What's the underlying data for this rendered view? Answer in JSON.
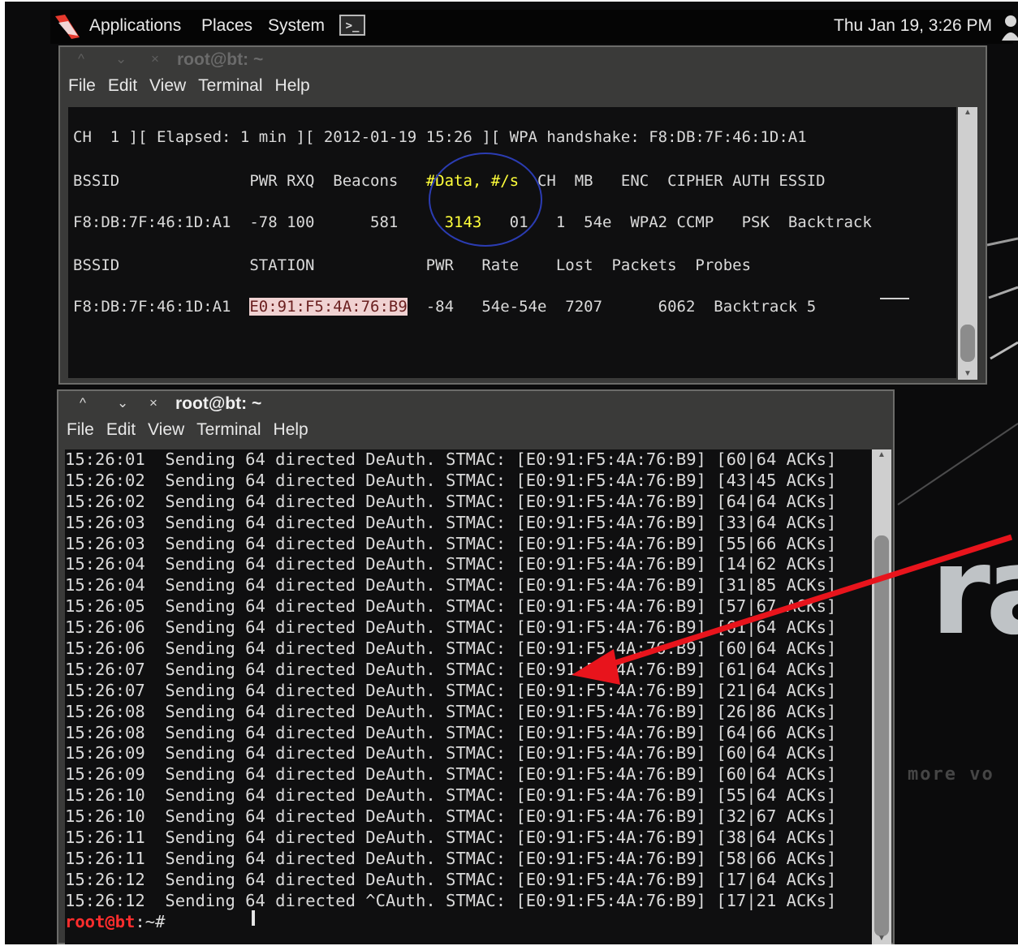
{
  "panel": {
    "menus": [
      "Applications",
      "Places",
      "System"
    ],
    "clock": "Thu Jan 19,  3:26 PM",
    "logo_icon": "backtrack-dragon-logo",
    "terminal_icon_label": ">_"
  },
  "window1": {
    "title": "root@bt: ~",
    "menu": [
      "File",
      "Edit",
      "View",
      "Terminal",
      "Help"
    ],
    "status_line": "CH  1 ][ Elapsed: 1 min ][ 2012-01-19 15:26 ][ WPA handshake: F8:DB:7F:46:1D:A1",
    "ap_header_a": "BSSID              PWR RXQ  Beacons   ",
    "ap_header_data": "#Data, #/s",
    "ap_header_b": "  CH  MB   ENC  CIPHER AUTH ESSID",
    "ap_row_a": "F8:DB:7F:46:1D:A1  -78 100      581     ",
    "ap_row_data": "3143",
    "ap_row_b": "   01   1  54e  WPA2 CCMP   PSK  Backtrack",
    "st_header": "BSSID              STATION            PWR   Rate    Lost  Packets  Probes",
    "st_row_bssid": "F8:DB:7F:46:1D:A1  ",
    "st_row_station": "E0:91:F5:4A:76:B9",
    "st_row_rest": "  -84   54e-54e  7207      6062  Backtrack 5"
  },
  "window2": {
    "title": "root@bt: ~",
    "menu": [
      "File",
      "Edit",
      "View",
      "Terminal",
      "Help"
    ],
    "lines": [
      "15:26:01  Sending 64 directed DeAuth. STMAC: [E0:91:F5:4A:76:B9] [60|64 ACKs]",
      "15:26:02  Sending 64 directed DeAuth. STMAC: [E0:91:F5:4A:76:B9] [43|45 ACKs]",
      "15:26:02  Sending 64 directed DeAuth. STMAC: [E0:91:F5:4A:76:B9] [64|64 ACKs]",
      "15:26:03  Sending 64 directed DeAuth. STMAC: [E0:91:F5:4A:76:B9] [33|64 ACKs]",
      "15:26:03  Sending 64 directed DeAuth. STMAC: [E0:91:F5:4A:76:B9] [55|66 ACKs]",
      "15:26:04  Sending 64 directed DeAuth. STMAC: [E0:91:F5:4A:76:B9] [14|62 ACKs]",
      "15:26:04  Sending 64 directed DeAuth. STMAC: [E0:91:F5:4A:76:B9] [31|85 ACKs]",
      "15:26:05  Sending 64 directed DeAuth. STMAC: [E0:91:F5:4A:76:B9] [57|67 ACKs]",
      "15:26:06  Sending 64 directed DeAuth. STMAC: [E0:91:F5:4A:76:B9] [61|64 ACKs]",
      "15:26:06  Sending 64 directed DeAuth. STMAC: [E0:91:F5:4A:76:B9] [60|64 ACKs]",
      "15:26:07  Sending 64 directed DeAuth. STMAC: [E0:91:F5:4A:76:B9] [61|64 ACKs]",
      "15:26:07  Sending 64 directed DeAuth. STMAC: [E0:91:F5:4A:76:B9] [21|64 ACKs]",
      "15:26:08  Sending 64 directed DeAuth. STMAC: [E0:91:F5:4A:76:B9] [26|86 ACKs]",
      "15:26:08  Sending 64 directed DeAuth. STMAC: [E0:91:F5:4A:76:B9] [64|66 ACKs]",
      "15:26:09  Sending 64 directed DeAuth. STMAC: [E0:91:F5:4A:76:B9] [60|64 ACKs]",
      "15:26:09  Sending 64 directed DeAuth. STMAC: [E0:91:F5:4A:76:B9] [60|64 ACKs]",
      "15:26:10  Sending 64 directed DeAuth. STMAC: [E0:91:F5:4A:76:B9] [55|64 ACKs]",
      "15:26:10  Sending 64 directed DeAuth. STMAC: [E0:91:F5:4A:76:B9] [32|67 ACKs]",
      "15:26:11  Sending 64 directed DeAuth. STMAC: [E0:91:F5:4A:76:B9] [38|64 ACKs]",
      "15:26:11  Sending 64 directed DeAuth. STMAC: [E0:91:F5:4A:76:B9] [58|66 ACKs]",
      "15:26:12  Sending 64 directed DeAuth. STMAC: [E0:91:F5:4A:76:B9] [17|64 ACKs]",
      "15:26:12  Sending 64 directed ^CAuth. STMAC: [E0:91:F5:4A:76:B9] [17|21 ACKs]"
    ],
    "prompt_user": "root@bt",
    "prompt_rest": ":~#"
  },
  "desktop": {
    "brand_fragment": "ra",
    "colors": {
      "highlight_yellow": "#ffff3a",
      "circle_blue": "#2b3cb2",
      "arrow_red": "#e8141c",
      "prompt_red": "#ff2d2d"
    }
  }
}
